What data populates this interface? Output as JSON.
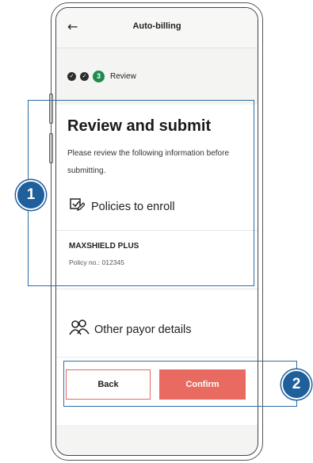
{
  "header": {
    "back_icon": "arrow-left-icon",
    "title": "Auto-billing"
  },
  "stepper": {
    "completed_steps": 2,
    "current_step_number": "3",
    "current_step_label": "Review"
  },
  "review": {
    "title": "Review and submit",
    "description": "Please review the following information before submitting."
  },
  "policies": {
    "icon": "edit-checkbox-icon",
    "heading": "Policies to enroll",
    "policy_name": "MAXSHIELD PLUS",
    "policy_number": "Policy no.: 012345"
  },
  "payor": {
    "icon": "people-icon",
    "heading": "Other payor details"
  },
  "actions": {
    "back_label": "Back",
    "confirm_label": "Confirm"
  },
  "callouts": {
    "one": "1",
    "two": "2"
  },
  "colors": {
    "accent": "#e96a60",
    "step_active": "#1f8a4c",
    "callout": "#1f5f9c"
  }
}
